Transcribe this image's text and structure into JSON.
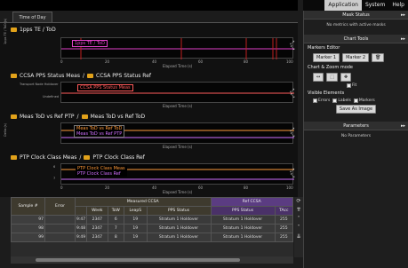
{
  "tabs": {
    "time_of_day": "Time of Day"
  },
  "charts": [
    {
      "title": "1pps TE / ToD",
      "ylabel": "1pps TE / ToD (s)",
      "legend": [
        "1pps TE / ToD"
      ],
      "legend_color": "#e040c8"
    },
    {
      "title_a": "CCSA PPS Status Meas",
      "title_sep": " / ",
      "title_b": "CCSA PPS Status Ref",
      "y_top": "Transport Node Holdover",
      "y_bottom": "Undefined",
      "legend": [
        "CCSA PPS Status Meas"
      ],
      "legend_color": "#ff5a5a"
    },
    {
      "title_a": "Meas ToD vs Ref PTP",
      "title_sep": " / ",
      "title_b": "Meas ToD vs Ref ToD",
      "ylabel": "Delta (s)",
      "legend": [
        "Meas ToD vs Ref ToD",
        "Meas ToD vs Ref PTP"
      ],
      "legend_colors": [
        "#ff9a3a",
        "#d070ff"
      ]
    },
    {
      "title_a": "PTP Clock Class Meas",
      "title_sep": " / ",
      "title_b": "PTP Clock Class Ref",
      "legend": [
        "PTP Clock Class Meas",
        "PTP Clock Class Ref"
      ],
      "legend_colors": [
        "#ff9a3a",
        "#d070ff"
      ],
      "y_top": "6",
      "y_bottom": "7"
    }
  ],
  "xaxis": {
    "ticks": [
      "0",
      "20",
      "40",
      "60",
      "80",
      "100"
    ],
    "label": "Elapsed Time (s)"
  },
  "table": {
    "col_sample": "Sample #",
    "col_error": "Error",
    "group_measured": "Measured CCSA",
    "group_ref": "Ref CCSA",
    "sub_cols": [
      "Week",
      "ToW",
      "LeapS",
      "PPS Status"
    ],
    "ref_sub_cols": [
      "PPS Status",
      "TAcc"
    ],
    "rows": [
      {
        "sample": "97",
        "time": "9:47",
        "week": "2347",
        "tow": "6",
        "leap": "19",
        "pps": "Stratum 1 Holdover",
        "ref_pps": "Stratum 1 Holdover",
        "tacc": "255"
      },
      {
        "sample": "98",
        "time": "9:48",
        "week": "2347",
        "tow": "7",
        "leap": "19",
        "pps": "Stratum 1 Holdover",
        "ref_pps": "Stratum 1 Holdover",
        "tacc": "255"
      },
      {
        "sample": "99",
        "time": "9:49",
        "week": "2347",
        "tow": "8",
        "leap": "19",
        "pps": "Stratum 1 Holdover",
        "ref_pps": "Stratum 1 Holdover",
        "tacc": "255"
      }
    ]
  },
  "menu": {
    "application": "Application",
    "system": "System",
    "help": "Help"
  },
  "panel": {
    "mask_status": "Mask Status",
    "mask_msg": "No metrics with active masks",
    "chart_tools": "Chart Tools",
    "markers_editor": "Markers Editor",
    "marker1": "Marker 1",
    "marker2": "Marker 2",
    "chart_zoom": "Chart & Zoom mode",
    "fit": "Fit",
    "visible_elements": "Visible Elements",
    "errors": "Errors",
    "labels": "Labels",
    "markers": "Markers",
    "save_as_image": "Save As Image",
    "parameters": "Parameters",
    "no_parameters": "No Parameters"
  }
}
